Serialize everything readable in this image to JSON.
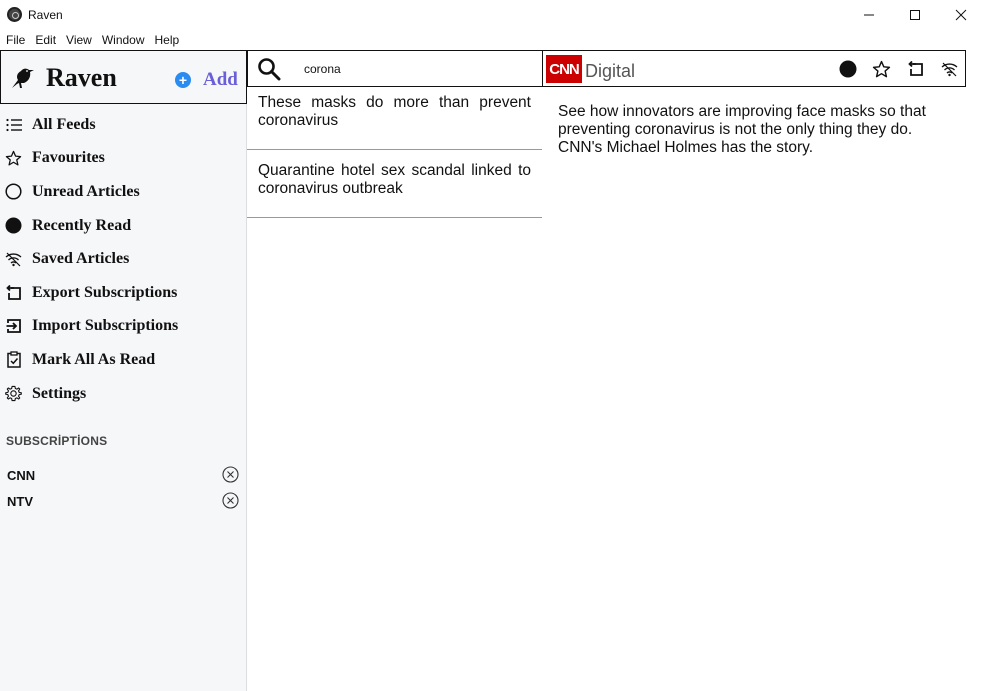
{
  "window": {
    "title": "Raven"
  },
  "menu": [
    "File",
    "Edit",
    "View",
    "Window",
    "Help"
  ],
  "brand": {
    "name": "Raven",
    "add_label": "Add"
  },
  "nav": [
    {
      "label": "All Feeds",
      "icon": "list-icon"
    },
    {
      "label": "Favourites",
      "icon": "star-icon"
    },
    {
      "label": "Unread Articles",
      "icon": "circle-outline-icon"
    },
    {
      "label": "Recently Read",
      "icon": "circle-filled-icon"
    },
    {
      "label": "Saved Articles",
      "icon": "saved-wifi-icon"
    },
    {
      "label": "Export Subscriptions",
      "icon": "export-icon"
    },
    {
      "label": "Import Subscriptions",
      "icon": "import-icon"
    },
    {
      "label": "Mark All As Read",
      "icon": "clipboard-check-icon"
    },
    {
      "label": "Settings",
      "icon": "gear-icon"
    }
  ],
  "subscriptions": {
    "header": "SUBSCRİPTİONS",
    "items": [
      {
        "name": "CNN"
      },
      {
        "name": "NTV"
      }
    ]
  },
  "search": {
    "value": "corona"
  },
  "articles": [
    {
      "title": "These masks do more than prevent coronavirus"
    },
    {
      "title": "Quarantine hotel sex scandal linked to coronavirus outbreak"
    }
  ],
  "reader": {
    "logo_text": "CNN",
    "source": "Digital",
    "body": "See how innovators are improving face masks so that preventing coronavirus is not the only thing they do. CNN's Michael Holmes has the story."
  },
  "colors": {
    "accent": "#2a8cf0",
    "add_text": "#6a5fd8",
    "cnn_red": "#cc0000",
    "sidebar_bg": "#f6f7f9"
  }
}
